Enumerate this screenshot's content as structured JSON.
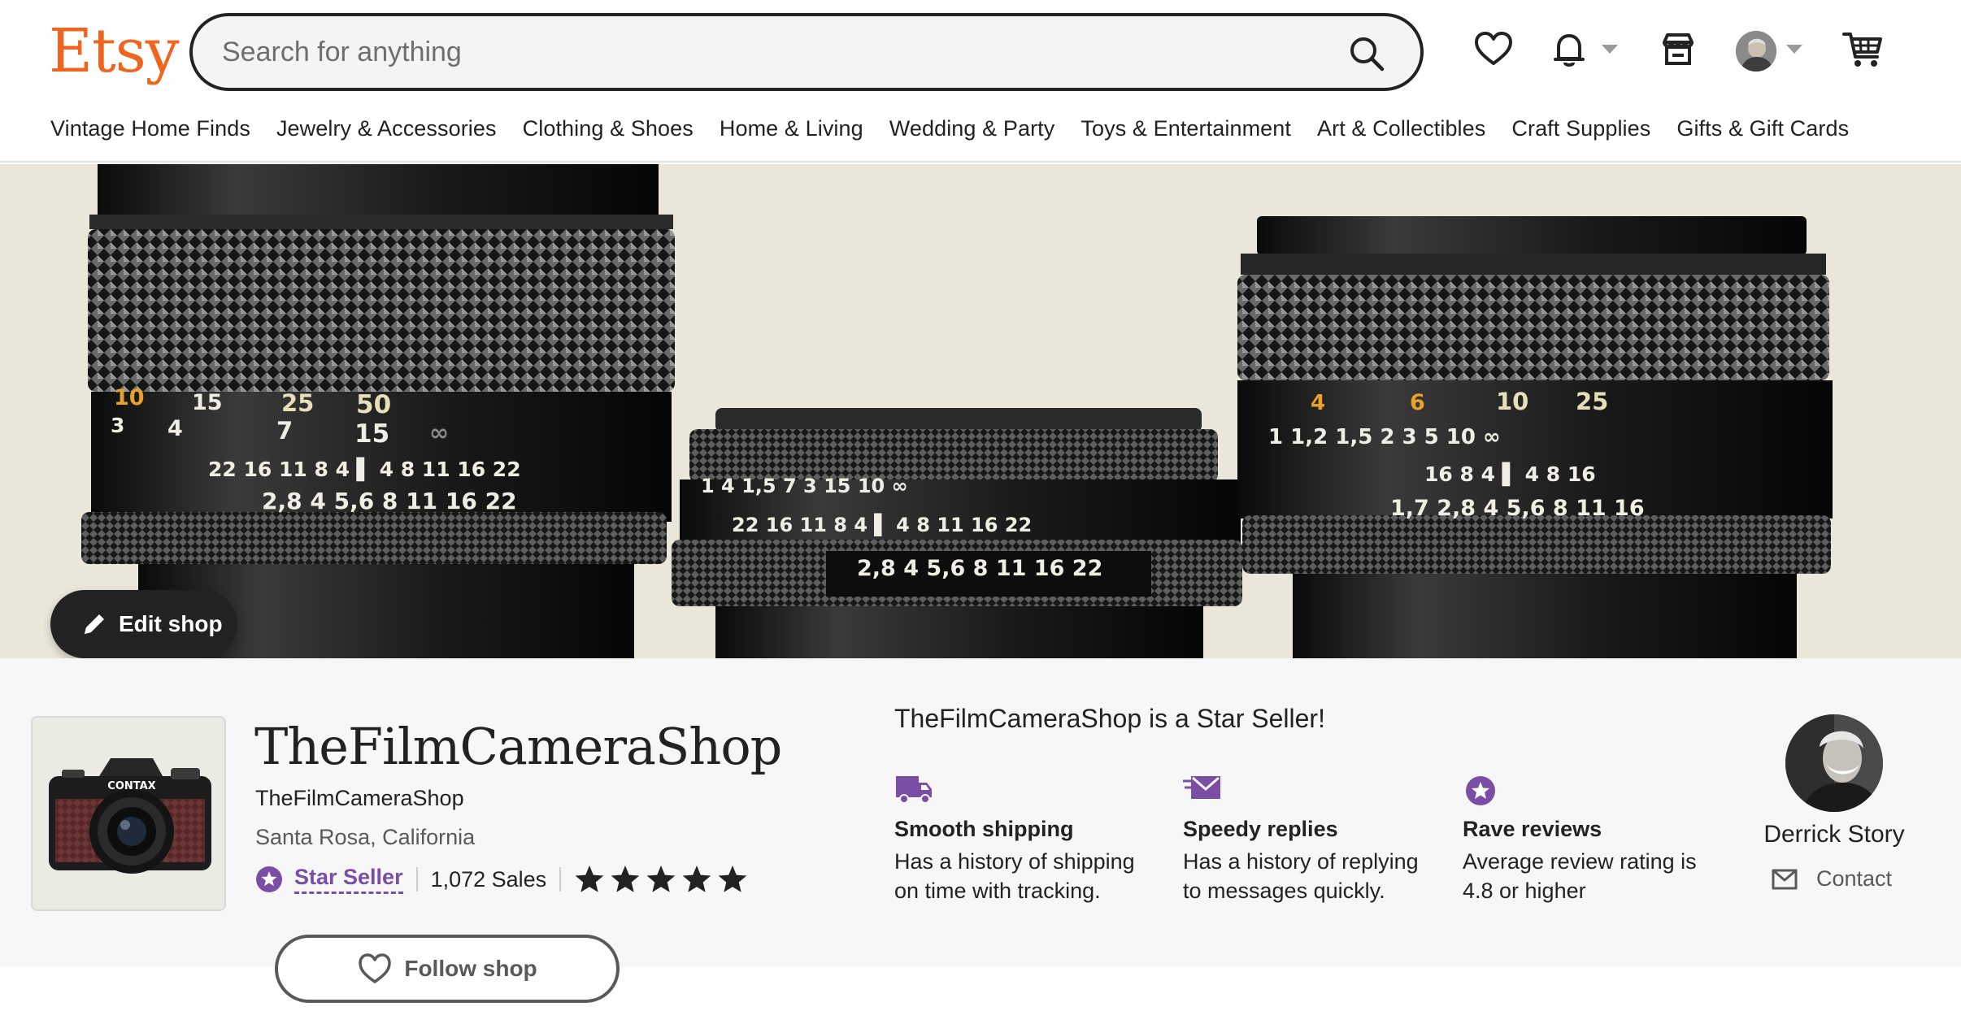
{
  "header": {
    "logo": "Etsy",
    "search_placeholder": "Search for anything",
    "icons": [
      "search-icon",
      "heart-icon",
      "bell-icon",
      "shop-manager-icon",
      "avatar",
      "cart-icon"
    ]
  },
  "categories": [
    "Vintage Home Finds",
    "Jewelry & Accessories",
    "Clothing & Shoes",
    "Home & Living",
    "Wedding & Party",
    "Toys & Entertainment",
    "Art & Collectibles",
    "Craft Supplies",
    "Gifts & Gift Cards"
  ],
  "banner": {
    "edit_label": "Edit shop",
    "lens_left": {
      "row1": "10  15  25  50",
      "row2": "3  4  7  15  ∞",
      "row3": "22 16 11 8 4 | 4 8 11 16 22",
      "row4": "2,8 4 5,6 8 11 16 22"
    },
    "lens_mid": {
      "row1": "1 4 1,5 7 3 15 10 ∞",
      "row2": "22 16 11 8 4 | 4 8 11 16 22",
      "row3": "2,8 4 5,6 8 11 16 22"
    },
    "lens_right": {
      "row1": "4  6  10  25",
      "row2": "1 1,2 1,5 2 3 5 10 ∞",
      "row3": "16 8 4 | 4 8 16",
      "row4": "1,7 2,8 4 5,6 8 11 16"
    }
  },
  "shop": {
    "title": "TheFilmCameraShop",
    "handle": "TheFilmCameraShop",
    "location": "Santa Rosa, California",
    "star_seller_label": "Star Seller",
    "sales": "1,072 Sales",
    "rating_stars": 5,
    "follow_label": "Follow shop",
    "icon_brand_text": "CONTAX"
  },
  "star_seller": {
    "heading": "TheFilmCameraShop is a Star Seller!",
    "perks": [
      {
        "icon": "truck-icon",
        "title": "Smooth shipping",
        "desc": "Has a history of shipping on time with tracking."
      },
      {
        "icon": "envelope-icon",
        "title": "Speedy replies",
        "desc": "Has a history of replying to messages quickly."
      },
      {
        "icon": "star-badge-icon",
        "title": "Rave reviews",
        "desc": "Average review rating is 4.8 or higher"
      }
    ]
  },
  "owner": {
    "name": "Derrick Story",
    "contact_label": "Contact"
  },
  "colors": {
    "brand": "#f1641e",
    "star_seller": "#7b4ea6",
    "banner_bg": "#ebe6da"
  }
}
